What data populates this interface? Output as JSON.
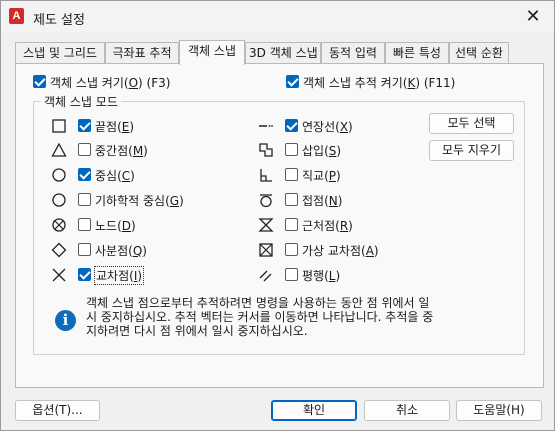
{
  "window": {
    "app_logo": "A",
    "title": "제도 설정",
    "close_glyph": "✕"
  },
  "tabs": [
    {
      "label": "스냅 및 그리드",
      "active": false
    },
    {
      "label": "극좌표 추적",
      "active": false
    },
    {
      "label": "객체 스냅",
      "active": true
    },
    {
      "label": "3D 객체 스냅",
      "active": false
    },
    {
      "label": "동적 입력",
      "active": false
    },
    {
      "label": "빠른 특성",
      "active": false
    },
    {
      "label": "선택 순환",
      "active": false
    }
  ],
  "options": {
    "osnap_on": {
      "pre": "객체 스냅 켜기(",
      "key": "O",
      "post": ") (F3)",
      "checked": true
    },
    "tracking_on": {
      "pre": "객체 스냅 추적 켜기(",
      "key": "K",
      "post": ") (F11)",
      "checked": true
    }
  },
  "group": {
    "title": "객체 스냅 모드",
    "left_modes": [
      {
        "icon": "endpoint-square-icon",
        "pre": "",
        "key": "끝점",
        "hot": "E",
        "post": "",
        "checked": true
      },
      {
        "icon": "midpoint-triangle-icon",
        "pre": "",
        "key": "중간점",
        "hot": "M",
        "post": "",
        "checked": false
      },
      {
        "icon": "center-circle-icon",
        "pre": "",
        "key": "중심",
        "hot": "C",
        "post": "",
        "checked": true
      },
      {
        "icon": "geometric-center-icon",
        "pre": "",
        "key": "기하학적 중심",
        "hot": "G",
        "post": "",
        "checked": false
      },
      {
        "icon": "node-icon",
        "pre": "",
        "key": "노드",
        "hot": "D",
        "post": "",
        "checked": false
      },
      {
        "icon": "quadrant-diamond-icon",
        "pre": "",
        "key": "사분점",
        "hot": "Q",
        "post": "",
        "checked": false
      },
      {
        "icon": "intersection-x-icon",
        "pre": "",
        "key": "교차점",
        "hot": "I",
        "post": "",
        "checked": true
      }
    ],
    "right_modes": [
      {
        "icon": "extension-icon",
        "key": "연장선",
        "hot": "X",
        "checked": true
      },
      {
        "icon": "insertion-icon",
        "key": "삽입",
        "hot": "S",
        "checked": false
      },
      {
        "icon": "perpendicular-icon",
        "key": "직교",
        "hot": "P",
        "checked": false
      },
      {
        "icon": "tangent-icon",
        "key": "접점",
        "hot": "N",
        "checked": false
      },
      {
        "icon": "nearest-icon",
        "key": "근처점",
        "hot": "R",
        "checked": false
      },
      {
        "icon": "apparent-intersection-icon",
        "key": "가상 교차점",
        "hot": "A",
        "checked": false
      },
      {
        "icon": "parallel-icon",
        "key": "평행",
        "hot": "L",
        "checked": false
      }
    ],
    "select_all": "모두 선택",
    "clear_all": "모두 지우기"
  },
  "info": {
    "line1": "객체 스냅 점으로부터 추적하려면 명령을 사용하는 동안 점 위에서 일",
    "line2": "시 중지하십시오. 추적 벡터는 커서를 이동하면 나타납니다. 추적을 중",
    "line3": "지하려면 다시 점 위에서 일시 중지하십시오."
  },
  "footer": {
    "options_label": "옵션(T)...",
    "ok_label": "확인",
    "cancel_label": "취소",
    "help_label": "도움말(H)"
  },
  "colors": {
    "accent": "#0067c0",
    "logo": "#d52a2a",
    "info": "#0f6cbd"
  }
}
